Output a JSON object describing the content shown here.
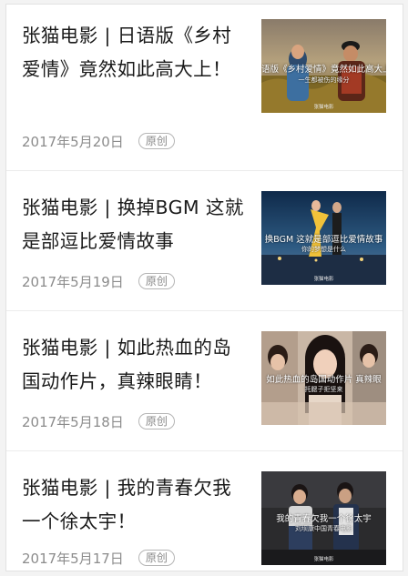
{
  "articles": [
    {
      "title": "张猫电影 | 日语版《乡村爱情》竟然如此高大上！",
      "date": "2017年5月20日",
      "badge": "原创",
      "thumb": {
        "caption": "语版《乡村爱情》竟然如此高大上",
        "sub": "一生都被伤的缘分",
        "credit": "张猫电影"
      }
    },
    {
      "title": "张猫电影 | 换掉BGM 这就是部逗比爱情故事",
      "date": "2017年5月19日",
      "badge": "原创",
      "thumb": {
        "caption": "换BGM 这就是部逗比爱情故事",
        "sub": "你的梦想是什么",
        "credit": "张猫电影"
      }
    },
    {
      "title": "张猫电影 | 如此热血的岛国动作片，真辣眼睛！",
      "date": "2017年5月18日",
      "badge": "原创",
      "thumb": {
        "caption": "如此热血的岛国动作片 真辣眼",
        "sub": "托腮子拒坚来",
        "credit": ""
      }
    },
    {
      "title": "张猫电影 | 我的青春欠我一个徐太宇！",
      "date": "2017年5月17日",
      "badge": "原创",
      "thumb": {
        "caption": "我的青春欠我一个徐太宇",
        "sub": "刘坝康中国青春电影",
        "credit": "张猫电影"
      }
    }
  ]
}
